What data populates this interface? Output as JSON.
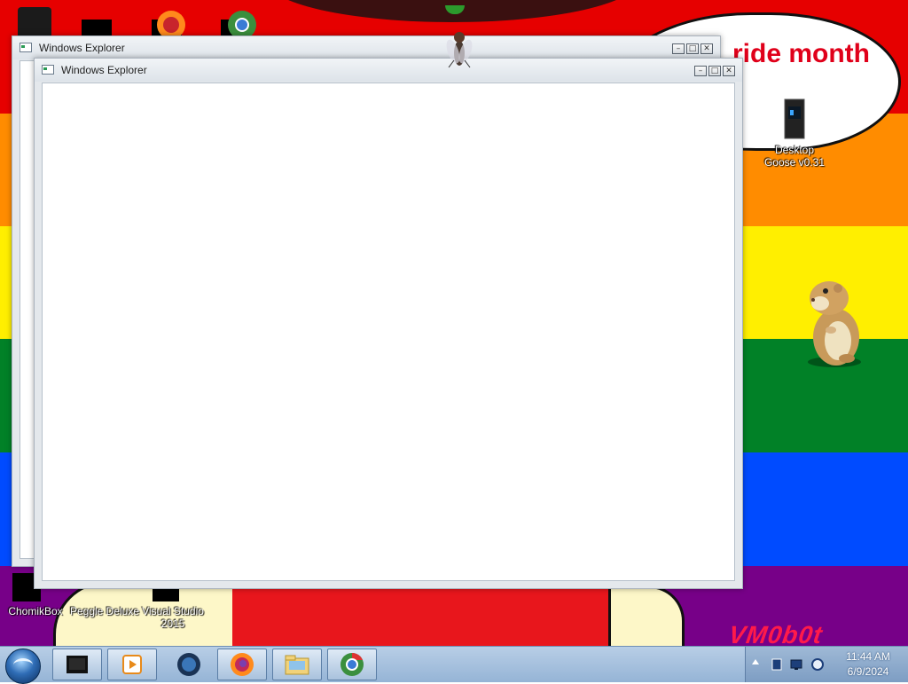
{
  "wallpaper": {
    "bubble_text": "ride month",
    "watermark": "VM0b0t",
    "colors": [
      "#e60000",
      "#ff8c00",
      "#ffef00",
      "#018127",
      "#004bff",
      "#770088"
    ]
  },
  "desktop_icons": [
    {
      "name": "desktop-goose",
      "label": "Desktop\nGoose v0.31",
      "icon": "server-tower-icon"
    },
    {
      "name": "chomikbox",
      "label": "ChomikBox",
      "icon": "chomikbox-icon"
    },
    {
      "name": "peggle-deluxe",
      "label": "Peggle Deluxe",
      "icon": "peggle-icon"
    },
    {
      "name": "visual-studio",
      "label": "Visual Studio\n2015",
      "icon": "visual-studio-icon"
    }
  ],
  "windows": {
    "back": {
      "title": "Windows Explorer"
    },
    "front": {
      "title": "Windows Explorer"
    },
    "controls": {
      "minimize": "–",
      "maximize": "□",
      "close": "✕"
    }
  },
  "taskbar": {
    "start_icon": "windows-start-orb",
    "buttons": [
      {
        "icon": "video-player-icon",
        "active": true
      },
      {
        "icon": "media-player-icon",
        "active": true
      },
      {
        "icon": "globe-icon",
        "active": false
      },
      {
        "icon": "firefox-icon",
        "active": true
      },
      {
        "icon": "explorer-folder-icon",
        "active": true
      },
      {
        "icon": "chrome-icon",
        "active": true
      }
    ],
    "tray": {
      "icons": [
        "show-hidden-icons",
        "network-icon",
        "monitor-icon",
        "volume-icon"
      ],
      "time": "11:44 AM",
      "date": "6/9/2024"
    }
  }
}
